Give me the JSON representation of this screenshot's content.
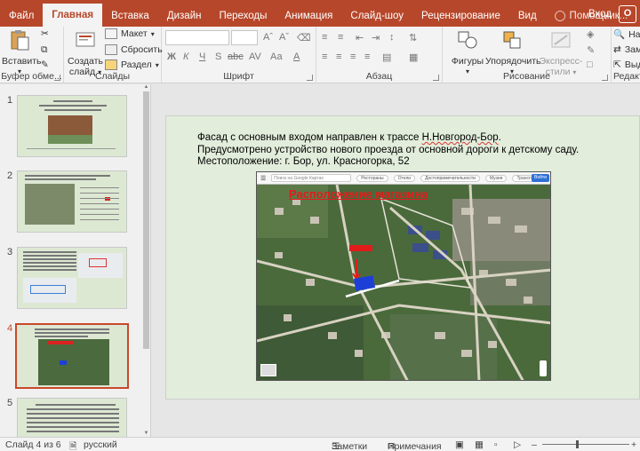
{
  "tabs": [
    {
      "label": "Файл",
      "active": false
    },
    {
      "label": "Главная",
      "active": true
    },
    {
      "label": "Вставка",
      "active": false
    },
    {
      "label": "Дизайн",
      "active": false
    },
    {
      "label": "Переходы",
      "active": false
    },
    {
      "label": "Анимация",
      "active": false
    },
    {
      "label": "Слайд-шоу",
      "active": false
    },
    {
      "label": "Рецензирование",
      "active": false
    },
    {
      "label": "Вид",
      "active": false
    }
  ],
  "tell_me": "Помощник...",
  "login": "Вход",
  "share_initial": "О",
  "ribbon": {
    "clipboard": {
      "paste": "Вставить",
      "label": "Буфер обме..."
    },
    "slides": {
      "new_slide_1": "Создать",
      "new_slide_2": "слайд",
      "layout": "Макет",
      "reset": "Сбросить",
      "section": "Раздел",
      "label": "Слайды"
    },
    "font": {
      "bold": "Ж",
      "italic": "К",
      "underline": "Ч",
      "strike": "S",
      "shadow": "abc",
      "spacing": "AV",
      "case": "Аа",
      "color": "А",
      "label": "Шрифт"
    },
    "paragraph": {
      "label": "Абзац"
    },
    "drawing": {
      "shapes": "Фигуры",
      "arrange": "Упорядочить",
      "quick_styles_1": "Экспресс-",
      "quick_styles_2": "стили",
      "label": "Рисование"
    },
    "editing": {
      "find": "Най",
      "replace": "Зам",
      "select": "Выд",
      "label": "Редакти"
    }
  },
  "thumbnails": [
    {
      "num": "1",
      "active": false
    },
    {
      "num": "2",
      "active": false
    },
    {
      "num": "3",
      "active": false
    },
    {
      "num": "4",
      "active": true
    },
    {
      "num": "5",
      "active": false
    }
  ],
  "slide": {
    "line1": "Фасад с основным входом направлен к трассе ",
    "line1_highlight": "Н.Новгород-Бор",
    "line1_end": ".",
    "line2": " Предусмотрено устройство нового проезда от основной дороги к детскому саду.",
    "line3": "Местоположение: г. Бор, ул. Красногорка, 52",
    "map_title": "Расположение магазина",
    "map_search": "Поиск на Google Картах",
    "map_chips": [
      "Рестораны",
      "Отели",
      "Достопримечательности",
      "Музеи",
      "Транспорт"
    ],
    "map_signin": "Войти"
  },
  "status": {
    "slide_of": "Слайд 4 из 6",
    "language": "русский",
    "notes": "Заметки",
    "comments": "Примечания"
  },
  "colors": {
    "accent": "#b7472a",
    "slide_bg": "#e2eddb",
    "map_title": "#e21b1b"
  }
}
